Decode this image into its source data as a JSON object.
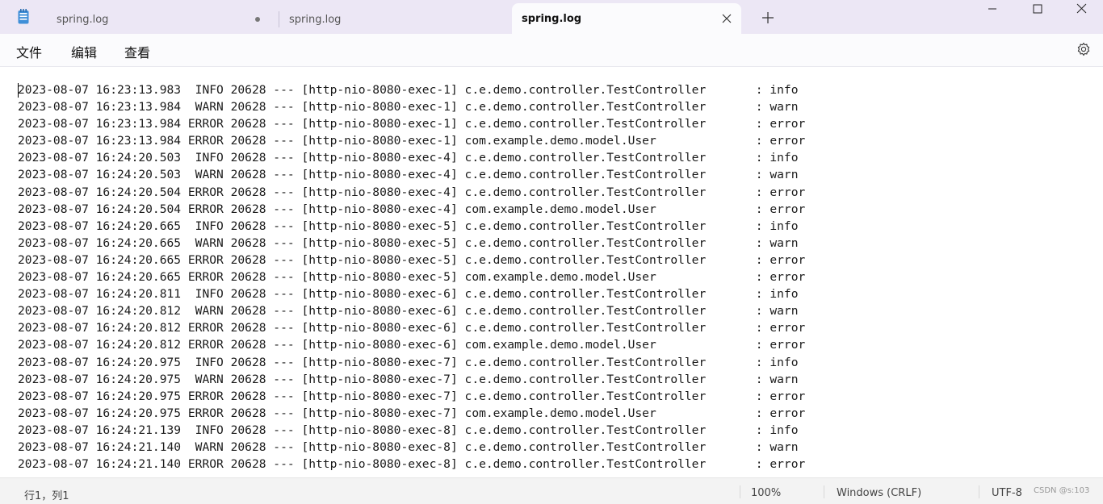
{
  "window": {
    "tabs": [
      {
        "label": "spring.log",
        "unsaved": true
      },
      {
        "label": "spring.log"
      },
      {
        "label": "spring.log",
        "active": true
      }
    ],
    "icons": {
      "app": "notepad-icon",
      "close_tab": "close-icon",
      "new_tab": "plus-icon",
      "minimize": "minimize-icon",
      "maximize": "maximize-icon",
      "close": "close-icon",
      "settings": "gear-icon"
    }
  },
  "menu": {
    "file": "文件",
    "edit": "编辑",
    "view": "查看"
  },
  "editor": {
    "lines": [
      "2023-08-07 16:23:13.983  INFO 20628 --- [http-nio-8080-exec-1] c.e.demo.controller.TestController       : info",
      "2023-08-07 16:23:13.984  WARN 20628 --- [http-nio-8080-exec-1] c.e.demo.controller.TestController       : warn",
      "2023-08-07 16:23:13.984 ERROR 20628 --- [http-nio-8080-exec-1] c.e.demo.controller.TestController       : error",
      "2023-08-07 16:23:13.984 ERROR 20628 --- [http-nio-8080-exec-1] com.example.demo.model.User              : error",
      "2023-08-07 16:24:20.503  INFO 20628 --- [http-nio-8080-exec-4] c.e.demo.controller.TestController       : info",
      "2023-08-07 16:24:20.503  WARN 20628 --- [http-nio-8080-exec-4] c.e.demo.controller.TestController       : warn",
      "2023-08-07 16:24:20.504 ERROR 20628 --- [http-nio-8080-exec-4] c.e.demo.controller.TestController       : error",
      "2023-08-07 16:24:20.504 ERROR 20628 --- [http-nio-8080-exec-4] com.example.demo.model.User              : error",
      "2023-08-07 16:24:20.665  INFO 20628 --- [http-nio-8080-exec-5] c.e.demo.controller.TestController       : info",
      "2023-08-07 16:24:20.665  WARN 20628 --- [http-nio-8080-exec-5] c.e.demo.controller.TestController       : warn",
      "2023-08-07 16:24:20.665 ERROR 20628 --- [http-nio-8080-exec-5] c.e.demo.controller.TestController       : error",
      "2023-08-07 16:24:20.665 ERROR 20628 --- [http-nio-8080-exec-5] com.example.demo.model.User              : error",
      "2023-08-07 16:24:20.811  INFO 20628 --- [http-nio-8080-exec-6] c.e.demo.controller.TestController       : info",
      "2023-08-07 16:24:20.812  WARN 20628 --- [http-nio-8080-exec-6] c.e.demo.controller.TestController       : warn",
      "2023-08-07 16:24:20.812 ERROR 20628 --- [http-nio-8080-exec-6] c.e.demo.controller.TestController       : error",
      "2023-08-07 16:24:20.812 ERROR 20628 --- [http-nio-8080-exec-6] com.example.demo.model.User              : error",
      "2023-08-07 16:24:20.975  INFO 20628 --- [http-nio-8080-exec-7] c.e.demo.controller.TestController       : info",
      "2023-08-07 16:24:20.975  WARN 20628 --- [http-nio-8080-exec-7] c.e.demo.controller.TestController       : warn",
      "2023-08-07 16:24:20.975 ERROR 20628 --- [http-nio-8080-exec-7] c.e.demo.controller.TestController       : error",
      "2023-08-07 16:24:20.975 ERROR 20628 --- [http-nio-8080-exec-7] com.example.demo.model.User              : error",
      "2023-08-07 16:24:21.139  INFO 20628 --- [http-nio-8080-exec-8] c.e.demo.controller.TestController       : info",
      "2023-08-07 16:24:21.140  WARN 20628 --- [http-nio-8080-exec-8] c.e.demo.controller.TestController       : warn",
      "2023-08-07 16:24:21.140 ERROR 20628 --- [http-nio-8080-exec-8] c.e.demo.controller.TestController       : error"
    ]
  },
  "status": {
    "position": "行1，列1",
    "zoom": "100%",
    "line_ending": "Windows (CRLF)",
    "encoding": "UTF-8",
    "watermark": "CSDN @s:103"
  },
  "colors": {
    "titlebar": "#ece7f5",
    "active_tab": "#fbfbfd",
    "statusbar": "#f3f3f3"
  }
}
